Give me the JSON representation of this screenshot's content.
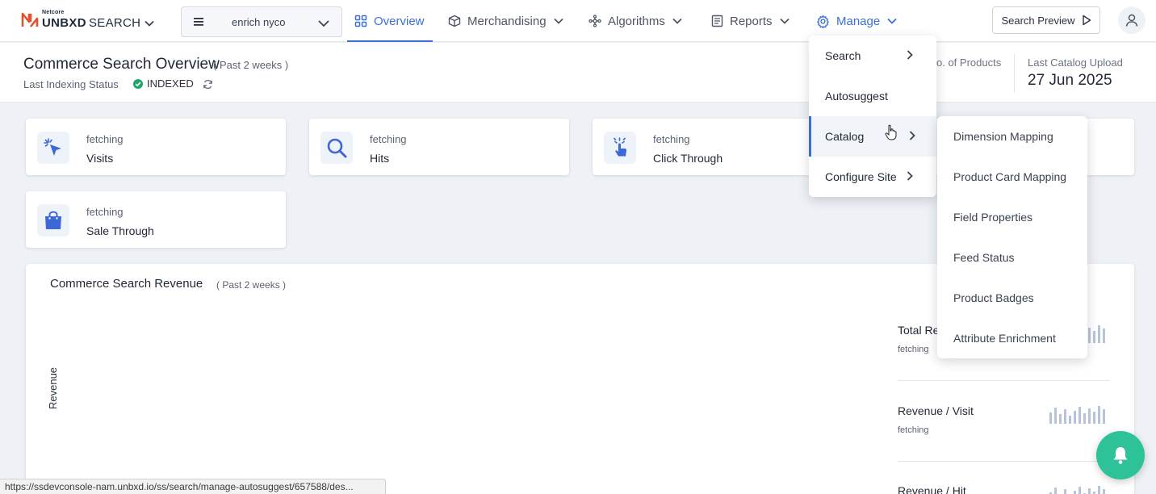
{
  "brand": {
    "top": "Netcore",
    "name": "UNBXD",
    "product": "SEARCH",
    "accent": "#e4512b"
  },
  "site_selector": {
    "value": "enrich nyco"
  },
  "nav": {
    "items": [
      {
        "label": "Overview",
        "icon": "grid-icon",
        "active": true
      },
      {
        "label": "Merchandising",
        "icon": "box-icon"
      },
      {
        "label": "Algorithms",
        "icon": "nodes-icon"
      },
      {
        "label": "Reports",
        "icon": "document-icon"
      },
      {
        "label": "Manage",
        "icon": "gear-icon",
        "open": true
      }
    ],
    "search_preview": "Search Preview"
  },
  "header": {
    "title": "Commerce Search Overview",
    "period": "( Past 2 weeks )",
    "indexing_label": "Last Indexing Status",
    "indexing_status": "INDEXED",
    "products_label": "o. of Products",
    "catalog_label": "Last Catalog Upload",
    "catalog_value": "27 Jun 2025"
  },
  "metrics": [
    {
      "status": "fetching",
      "name": "Visits",
      "icon": "cursor-click-icon"
    },
    {
      "status": "fetching",
      "name": "Hits",
      "icon": "search-icon"
    },
    {
      "status": "fetching",
      "name": "Click Through",
      "icon": "pointer-tap-icon"
    },
    {
      "status": "fetching",
      "name": "Sale Through",
      "icon": "shopping-bag-icon"
    }
  ],
  "revenue": {
    "title": "Commerce Search Revenue",
    "period": "( Past 2 weeks )",
    "axis_label": "Revenue",
    "kpis": [
      {
        "name": "Total Re",
        "value": "fetching"
      },
      {
        "name": "Revenue / Visit",
        "value": "fetching"
      },
      {
        "name": "Revenue / Hit",
        "value": ""
      }
    ]
  },
  "manage_menu": {
    "items": [
      {
        "label": "Search",
        "has_submenu": true
      },
      {
        "label": "Autosuggest",
        "has_submenu": false
      },
      {
        "label": "Catalog",
        "has_submenu": true,
        "selected": true
      },
      {
        "label": "Configure Site",
        "has_submenu": true
      }
    ]
  },
  "catalog_submenu": {
    "items": [
      "Dimension Mapping",
      "Product Card Mapping",
      "Field Properties",
      "Feed Status",
      "Product Badges",
      "Attribute Enrichment"
    ]
  },
  "status_bar": {
    "url": "https://ssdevconsole-nam.unbxd.io/ss/search/manage-autosuggest/657588/des..."
  },
  "colors": {
    "primary": "#3b6fd6",
    "success": "#1fa66a",
    "fab": "#2ec299"
  }
}
